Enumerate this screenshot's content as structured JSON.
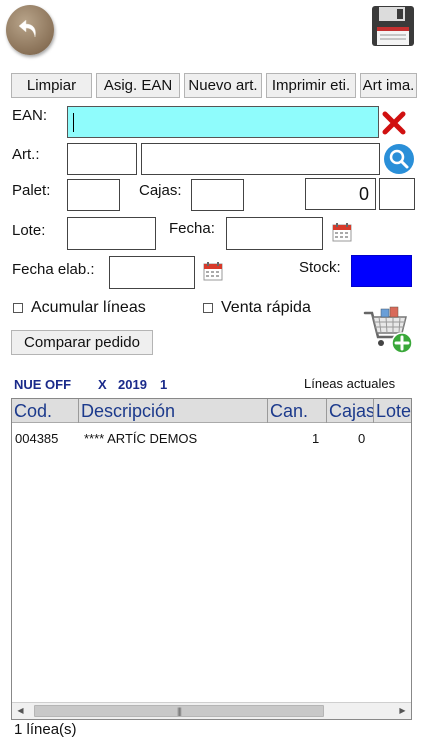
{
  "icons": {
    "back": "back-arrow-icon",
    "save": "floppy-disk-icon",
    "clear": "close-icon",
    "search": "search-icon",
    "calendar": "calendar-icon",
    "cart": "cart-add-icon"
  },
  "colors": {
    "ean_field": "#8ffcfc",
    "stock_field": "#0000ff",
    "clear_icon": "#d01010",
    "search_icon": "#2a8fd8",
    "info_text": "#1a2a8a",
    "header_text": "#1c3a8c"
  },
  "toolbar": {
    "clear_label": "Limpiar",
    "assign_ean_label": "Asig. EAN",
    "new_item_label": "Nuevo art.",
    "print_label_label": "Imprimir eti.",
    "item_image_label": "Art ima."
  },
  "form": {
    "ean_label": "EAN:",
    "ean_value": "",
    "item_label": "Art.:",
    "item_code_value": "",
    "item_desc_value": "",
    "pallet_label": "Palet:",
    "pallet_value": "",
    "boxes_label": "Cajas:",
    "boxes_value": "",
    "quantity_value": "0",
    "unit_value": "",
    "lot_label": "Lote:",
    "lot_value": "",
    "date_label": "Fecha:",
    "date_value": "",
    "mfg_date_label": "Fecha elab.:",
    "mfg_date_value": "",
    "stock_label": "Stock:",
    "accumulate_label": "Acumular líneas",
    "accumulate_checked": false,
    "quick_sale_label": "Venta rápida",
    "quick_sale_checked": false,
    "compare_order_label": "Comparar pedido"
  },
  "info": {
    "doc_left": "NUE OFF",
    "doc_x": "X",
    "doc_year": "2019",
    "doc_num": "1",
    "current_lines_label": "Líneas actuales"
  },
  "table": {
    "columns": [
      "Cod.",
      "Descripción",
      "Can.",
      "Cajas",
      "Lote"
    ],
    "rows": [
      {
        "code": "004385",
        "description": "**** ARTÍC DEMOS",
        "quantity": "1",
        "boxes": "0",
        "lot": ""
      }
    ]
  },
  "status": {
    "line_count": "1 línea(s)"
  }
}
